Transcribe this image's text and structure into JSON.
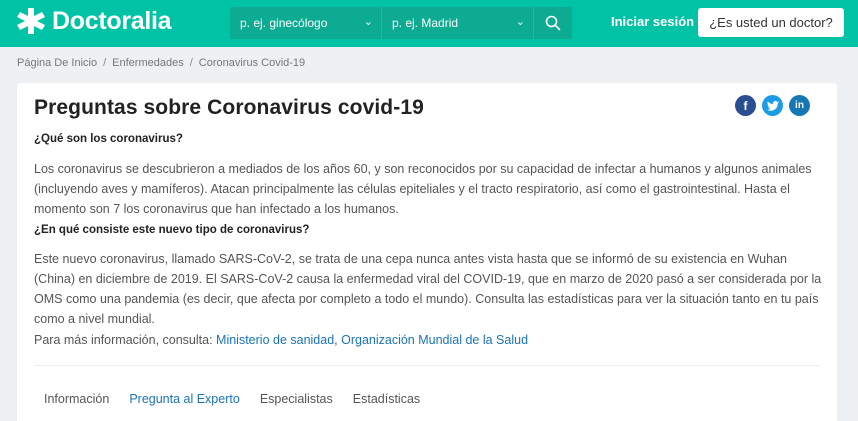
{
  "brand": {
    "name": "Doctoralia",
    "accent": "#00c3a5",
    "link_color": "#1a73b9"
  },
  "search": {
    "specialty_placeholder": "p. ej. ginecólogo",
    "location_placeholder": "p. ej. Madrid",
    "icons": [
      "chevron-down-icon",
      "search-icon"
    ]
  },
  "header": {
    "login_label": "Iniciar sesión",
    "doctor_label": "¿Es usted un doctor?"
  },
  "breadcrumb": {
    "items": [
      "Página De Inicio",
      "Enfermedades",
      "Coronavirus Covid-19"
    ],
    "separator": "/"
  },
  "article": {
    "title": "Preguntas sobre Coronavirus covid-19",
    "social_icons": [
      "facebook-icon",
      "twitter-icon",
      "linkedin-icon"
    ],
    "q1": "¿Qué son los coronavirus?",
    "p1": "Los coronavirus se descubrieron a mediados de los años 60, y son reconocidos por su capacidad de infectar a humanos y algunos animales (incluyendo aves y mamíferos). Atacan principalmente las células epiteliales y el tracto respiratorio, así como el gastrointestinal. Hasta el momento son 7 los coronavirus que han infectado a los humanos.",
    "q2": "¿En qué consiste este nuevo tipo de coronavirus?",
    "p2": "Este nuevo coronavirus, llamado SARS-CoV-2, se trata de una cepa nunca antes vista hasta que se informó de su existencia en Wuhan (China) en diciembre de 2019. El SARS-CoV-2 causa la enfermedad viral del COVID-19, que en marzo de 2020 pasó a ser considerada por la OMS como una pandemia (es decir, que afecta por completo a todo el mundo). Consulta las estadísticas para ver la situación tanto en tu país como a nivel mundial.",
    "info_prefix": "Para más información, consulta: ",
    "link1": "Ministerio de sanidad",
    "link_sep": ", ",
    "link2": "Organización Mundial de la Salud"
  },
  "tabs": [
    {
      "label": "Información",
      "active": false
    },
    {
      "label": "Pregunta al Experto",
      "active": true
    },
    {
      "label": "Especialistas",
      "active": false
    },
    {
      "label": "Estadísticas",
      "active": false
    }
  ]
}
